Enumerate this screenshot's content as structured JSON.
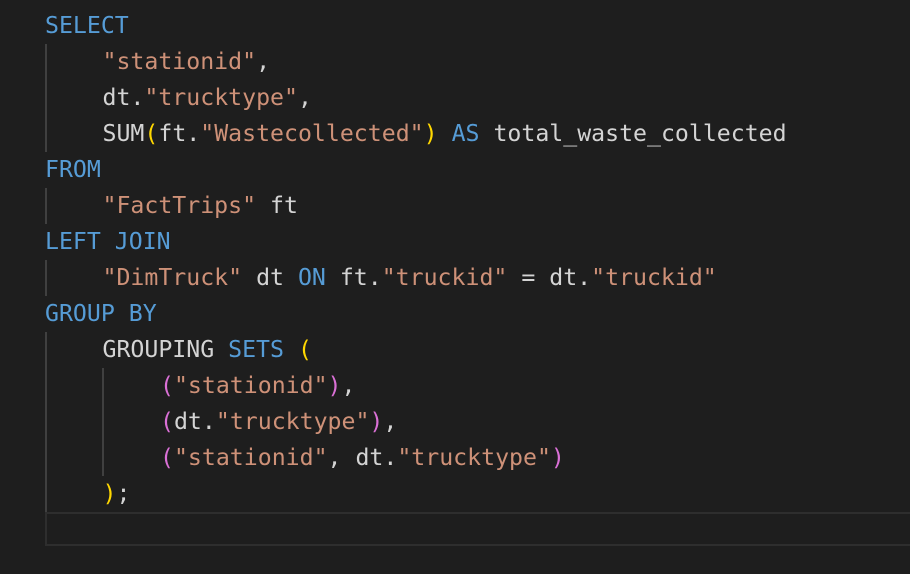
{
  "colors": {
    "background": "#1e1e1e",
    "keyword": "#569cd6",
    "string": "#ce9178",
    "text": "#d4d4d4",
    "bracket_level1": "#ffd700",
    "bracket_level2": "#da70d6",
    "indent_guide": "#404040"
  },
  "code": {
    "lines": [
      {
        "indent": 0,
        "tokens": [
          {
            "t": "SELECT",
            "c": "kw"
          }
        ]
      },
      {
        "indent": 1,
        "tokens": [
          {
            "t": "\"stationid\"",
            "c": "str"
          },
          {
            "t": ",",
            "c": "plain"
          }
        ]
      },
      {
        "indent": 1,
        "tokens": [
          {
            "t": "dt.",
            "c": "plain"
          },
          {
            "t": "\"trucktype\"",
            "c": "str"
          },
          {
            "t": ",",
            "c": "plain"
          }
        ]
      },
      {
        "indent": 1,
        "tokens": [
          {
            "t": "SUM",
            "c": "plain"
          },
          {
            "t": "(",
            "c": "br1"
          },
          {
            "t": "ft.",
            "c": "plain"
          },
          {
            "t": "\"Wastecollected\"",
            "c": "str"
          },
          {
            "t": ")",
            "c": "br1"
          },
          {
            "t": " ",
            "c": "plain"
          },
          {
            "t": "AS",
            "c": "kw"
          },
          {
            "t": " total_waste_collected",
            "c": "plain"
          }
        ]
      },
      {
        "indent": 0,
        "tokens": [
          {
            "t": "FROM",
            "c": "kw"
          }
        ]
      },
      {
        "indent": 1,
        "tokens": [
          {
            "t": "\"FactTrips\"",
            "c": "str"
          },
          {
            "t": " ft",
            "c": "plain"
          }
        ]
      },
      {
        "indent": 0,
        "tokens": [
          {
            "t": "LEFT JOIN",
            "c": "kw"
          }
        ]
      },
      {
        "indent": 1,
        "tokens": [
          {
            "t": "\"DimTruck\"",
            "c": "str"
          },
          {
            "t": " dt ",
            "c": "plain"
          },
          {
            "t": "ON",
            "c": "kw"
          },
          {
            "t": " ft.",
            "c": "plain"
          },
          {
            "t": "\"truckid\"",
            "c": "str"
          },
          {
            "t": " = dt.",
            "c": "plain"
          },
          {
            "t": "\"truckid\"",
            "c": "str"
          }
        ]
      },
      {
        "indent": 0,
        "tokens": [
          {
            "t": "GROUP BY",
            "c": "kw"
          }
        ]
      },
      {
        "indent": 1,
        "tokens": [
          {
            "t": "GROUPING ",
            "c": "plain"
          },
          {
            "t": "SETS",
            "c": "kw"
          },
          {
            "t": " ",
            "c": "plain"
          },
          {
            "t": "(",
            "c": "br1"
          }
        ]
      },
      {
        "indent": 2,
        "tokens": [
          {
            "t": "(",
            "c": "br2"
          },
          {
            "t": "\"stationid\"",
            "c": "str"
          },
          {
            "t": ")",
            "c": "br2"
          },
          {
            "t": ",",
            "c": "plain"
          }
        ]
      },
      {
        "indent": 2,
        "tokens": [
          {
            "t": "(",
            "c": "br2"
          },
          {
            "t": "dt.",
            "c": "plain"
          },
          {
            "t": "\"trucktype\"",
            "c": "str"
          },
          {
            "t": ")",
            "c": "br2"
          },
          {
            "t": ",",
            "c": "plain"
          }
        ]
      },
      {
        "indent": 2,
        "tokens": [
          {
            "t": "(",
            "c": "br2"
          },
          {
            "t": "\"stationid\"",
            "c": "str"
          },
          {
            "t": ", dt.",
            "c": "plain"
          },
          {
            "t": "\"trucktype\"",
            "c": "str"
          },
          {
            "t": ")",
            "c": "br2"
          }
        ]
      },
      {
        "indent": 1,
        "tokens": [
          {
            "t": ")",
            "c": "br1"
          },
          {
            "t": ";",
            "c": "plain"
          }
        ]
      }
    ]
  }
}
